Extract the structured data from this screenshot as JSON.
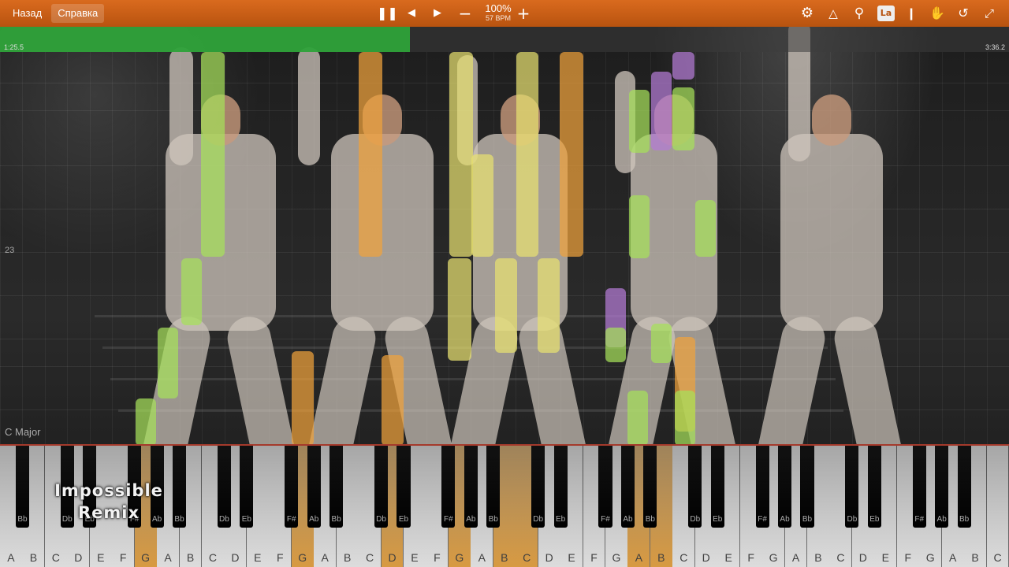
{
  "toolbar": {
    "back_label": "Назад",
    "help_label": "Справка",
    "icons": [
      "pause-icon",
      "previous-icon",
      "next-icon",
      "minus-icon",
      "plus-icon",
      "gear-icon",
      "metronome-icon",
      "magnifier-icon",
      "label-icon",
      "bookmark-icon",
      "hand-icon",
      "loop-icon",
      "exit-fullscreen-icon"
    ],
    "label_icon_text": "La",
    "speed_percent": "100%",
    "bpm_label": "57 BPM"
  },
  "progress": {
    "fraction": 0.406,
    "current_time": "1:25.5",
    "total_time": "3:36.2",
    "bar_color": "#2fa83a"
  },
  "side_labels": {
    "measure": "23",
    "key_signature": "C Major"
  },
  "colors": {
    "toolbar": "#c85f16",
    "note_green": "#a6e05a",
    "note_orange": "#f0a23c",
    "note_yellow": "#e8e070",
    "note_purple": "#b47bd6",
    "key_red_line": "#a53a2c"
  },
  "keyboard": {
    "white_keys": [
      "A",
      "B",
      "C",
      "D",
      "E",
      "F",
      "G",
      "A",
      "B",
      "C",
      "D",
      "E",
      "F",
      "G",
      "A",
      "B",
      "C",
      "D",
      "E",
      "F",
      "G",
      "A",
      "B",
      "C",
      "D",
      "E",
      "F",
      "G",
      "A",
      "B",
      "C",
      "D",
      "E",
      "F",
      "G",
      "A",
      "B",
      "C",
      "D",
      "E",
      "F",
      "G",
      "A",
      "B",
      "C"
    ],
    "black_keys": [
      "Bb",
      "Db",
      "Eb",
      "F#",
      "Ab",
      "Bb",
      "Db",
      "Eb",
      "F#",
      "Ab",
      "Bb",
      "Db",
      "Eb",
      "F#",
      "Ab",
      "Bb",
      "Db",
      "Eb",
      "F#",
      "Ab",
      "Bb",
      "Db",
      "Eb",
      "F#",
      "Ab",
      "Bb",
      "Db",
      "Eb",
      "F#",
      "Ab",
      "Bb",
      "Db"
    ]
  },
  "watermark": {
    "line1": "Impossible",
    "line2": "Remix"
  }
}
